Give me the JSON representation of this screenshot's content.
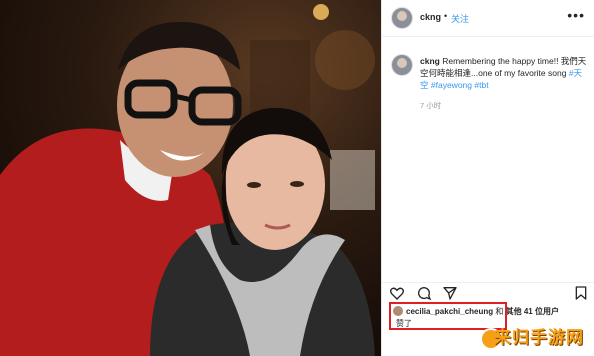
{
  "post": {
    "username": "ckng",
    "separator": "•",
    "follow_label": "关注",
    "more_icon": "more-horizontal-icon",
    "caption": {
      "username": "ckng",
      "text": " Remembering the happy time!! 我們天空何時能相逢...one of my favorite song ",
      "hashtags": [
        "#天空",
        "#fayewong",
        "#tbt"
      ]
    },
    "time_ago": "7 小时",
    "likes": {
      "liker": "cecilia_pakchi_cheung",
      "connector": " 和 ",
      "others": "其他 41 位用户",
      "suffix": "赞了"
    },
    "watermark": "来归手游网"
  },
  "colors": {
    "link_blue": "#3897f0",
    "highlight_red": "#e02020",
    "watermark_orange": "#f6a017"
  }
}
